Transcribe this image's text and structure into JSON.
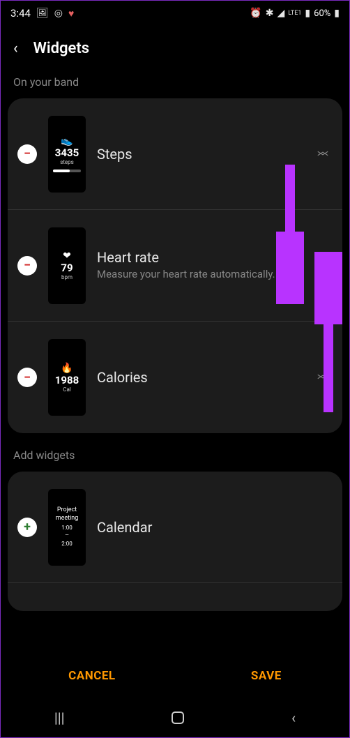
{
  "status": {
    "time": "3:44",
    "battery": "60%",
    "network": "LTE1"
  },
  "header": {
    "title": "Widgets"
  },
  "sections": {
    "on_band_label": "On your band",
    "add_widgets_label": "Add widgets"
  },
  "on_band": [
    {
      "title": "Steps",
      "subtitle": "",
      "thumb_main": "3435",
      "thumb_sub": "steps",
      "thumb_icon": "👟"
    },
    {
      "title": "Heart rate",
      "subtitle": "Measure your heart rate automatically.",
      "thumb_main": "79",
      "thumb_sub": "bpm",
      "thumb_icon": "❤"
    },
    {
      "title": "Calories",
      "subtitle": "",
      "thumb_main": "1988",
      "thumb_sub": "Cal",
      "thumb_icon": "🔥"
    }
  ],
  "add_widgets": [
    {
      "title": "Calendar",
      "thumb_line1": "Project meeting",
      "thumb_line2_a": "1:00",
      "thumb_line2_b": "2:00"
    }
  ],
  "actions": {
    "cancel": "CANCEL",
    "save": "SAVE"
  }
}
